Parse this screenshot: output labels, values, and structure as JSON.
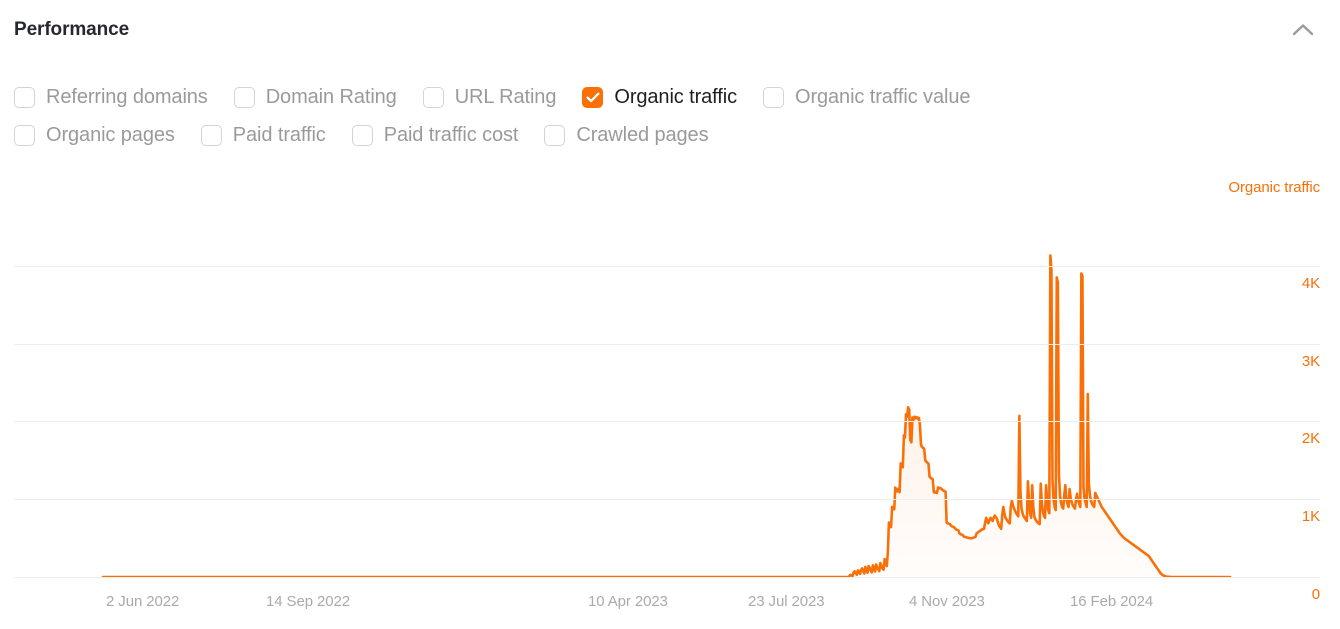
{
  "header": {
    "title": "Performance",
    "collapse_icon": "chevron-up-icon"
  },
  "metrics": {
    "rows": [
      [
        {
          "label": "Referring domains",
          "checked": false
        },
        {
          "label": "Domain Rating",
          "checked": false
        },
        {
          "label": "URL Rating",
          "checked": false
        },
        {
          "label": "Organic traffic",
          "checked": true
        },
        {
          "label": "Organic traffic value",
          "checked": false
        }
      ],
      [
        {
          "label": "Organic pages",
          "checked": false
        },
        {
          "label": "Paid traffic",
          "checked": false
        },
        {
          "label": "Paid traffic cost",
          "checked": false
        },
        {
          "label": "Crawled pages",
          "checked": false
        }
      ]
    ]
  },
  "chart_data": {
    "type": "area",
    "title": "Performance",
    "series_label": "Organic traffic",
    "accent_color": "#F97008",
    "fill_color": "#FDF0E3",
    "grid": true,
    "legend_position": "top-right",
    "xlabel": "",
    "ylabel": "Organic traffic",
    "ylim": [
      0,
      4600
    ],
    "yticks": [
      "0",
      "1K",
      "2K",
      "3K",
      "4K"
    ],
    "ytick_values": [
      0,
      1000,
      2000,
      3000,
      4000
    ],
    "xtick_labels": [
      "2 Jun 2022",
      "14 Sep 2022",
      "10 Apr 2023",
      "23 Jul 2023",
      "4 Nov 2023",
      "16 Feb 2024"
    ],
    "xtick_positions": [
      106,
      266,
      588,
      748,
      909,
      1070
    ],
    "x_start_label": "2 Jun 2022",
    "x_end_label": "16 Feb 2024",
    "values": [
      0,
      0,
      0,
      0,
      0,
      0,
      0,
      0,
      0,
      0,
      0,
      0,
      0,
      0,
      0,
      0,
      0,
      0,
      0,
      0,
      0,
      0,
      0,
      0,
      0,
      0,
      0,
      0,
      0,
      0,
      0,
      0,
      0,
      0,
      0,
      0,
      0,
      0,
      0,
      0,
      0,
      0,
      0,
      0,
      0,
      0,
      0,
      0,
      0,
      0,
      0,
      0,
      0,
      0,
      0,
      0,
      0,
      0,
      0,
      0,
      0,
      0,
      0,
      0,
      0,
      0,
      0,
      0,
      0,
      0,
      0,
      0,
      0,
      0,
      0,
      0,
      0,
      0,
      0,
      0,
      0,
      0,
      0,
      0,
      0,
      0,
      0,
      0,
      0,
      0,
      0,
      0,
      0,
      0,
      0,
      0,
      0,
      0,
      0,
      0,
      0,
      0,
      0,
      0,
      0,
      0,
      0,
      0,
      0,
      0,
      0,
      0,
      0,
      0,
      0,
      0,
      0,
      0,
      0,
      0,
      0,
      0,
      0,
      0,
      0,
      0,
      0,
      0,
      0,
      0,
      0,
      0,
      0,
      0,
      0,
      0,
      0,
      0,
      0,
      0,
      0,
      0,
      0,
      0,
      0,
      0,
      0,
      0,
      0,
      0,
      0,
      0,
      0,
      0,
      0,
      0,
      0,
      0,
      0,
      0,
      0,
      0,
      0,
      0,
      0,
      0,
      0,
      0,
      0,
      0,
      0,
      0,
      0,
      0,
      0,
      0,
      0,
      0,
      0,
      0,
      0,
      0,
      0,
      0,
      0,
      0,
      0,
      0,
      0,
      0,
      0,
      0,
      0,
      0,
      0,
      0,
      0,
      0,
      0,
      0,
      0,
      0,
      0,
      0,
      0,
      0,
      0,
      0,
      0,
      0,
      0,
      0,
      0,
      0,
      0,
      0,
      0,
      0,
      0,
      0,
      0,
      0,
      0,
      0,
      0,
      0,
      0,
      0,
      0,
      0,
      0,
      0,
      0,
      0,
      0,
      0,
      0,
      0,
      0,
      0,
      0,
      0,
      0,
      0,
      0,
      0,
      0,
      0,
      0,
      0,
      0,
      0,
      0,
      0,
      0,
      0,
      0,
      0,
      0,
      0,
      0,
      0,
      0,
      0,
      0,
      0,
      0,
      0,
      0,
      0,
      0,
      0,
      0,
      0,
      0,
      0,
      0,
      0,
      0,
      0,
      0,
      0,
      0,
      0,
      0,
      0,
      0,
      0,
      0,
      0,
      0,
      0,
      0,
      0,
      0,
      0,
      0,
      0,
      0,
      0,
      0,
      0,
      0,
      0,
      0,
      0,
      0,
      0,
      0,
      0,
      0,
      0,
      0,
      0,
      0,
      0,
      0,
      0,
      0,
      0,
      0,
      0,
      0,
      0,
      0,
      0,
      0,
      0,
      0,
      0,
      0,
      0,
      0,
      0,
      0,
      0,
      0,
      0,
      0,
      0,
      0,
      0,
      0,
      0,
      0,
      0,
      0,
      0,
      0,
      0,
      0,
      0,
      0,
      0,
      0,
      0,
      0,
      0,
      0,
      0,
      0,
      0,
      0,
      0,
      0,
      0,
      0,
      0,
      0,
      0,
      0,
      0,
      0,
      0,
      0,
      0,
      0,
      0,
      0,
      0,
      0,
      0,
      0,
      0,
      0,
      0,
      0,
      0,
      0,
      0,
      0,
      0,
      0,
      0,
      0,
      0,
      0,
      0,
      0,
      0,
      0,
      0,
      0,
      0,
      0,
      0,
      0,
      0,
      0,
      0,
      0,
      0,
      0,
      0,
      0,
      0,
      0,
      0,
      0,
      0,
      0,
      0,
      0,
      0,
      0,
      0,
      0,
      0,
      0,
      0,
      0,
      0,
      0,
      0,
      0,
      0,
      0,
      0,
      0,
      0,
      0,
      0,
      0,
      0,
      0,
      0,
      0,
      0,
      0,
      0,
      0,
      0,
      0,
      0,
      0,
      0,
      0,
      0,
      0,
      0,
      0,
      0,
      0,
      0,
      0,
      0,
      0,
      0,
      0,
      0,
      0,
      0,
      0,
      0,
      0,
      0,
      0,
      0,
      0,
      0,
      0,
      0,
      0,
      0,
      0,
      0,
      0,
      0,
      0,
      0,
      0,
      0,
      0,
      0,
      0,
      0,
      0,
      0,
      0,
      0,
      0,
      0,
      0,
      0,
      0,
      0,
      0,
      0,
      0,
      0,
      0,
      0,
      0,
      0,
      0,
      0,
      0,
      0,
      0,
      0,
      0,
      0,
      0,
      0,
      0,
      0,
      0,
      0,
      0,
      0,
      0,
      0,
      0,
      0,
      0,
      0,
      0,
      0,
      0,
      0,
      0,
      0,
      0,
      0,
      0,
      0,
      0,
      0,
      0,
      0,
      0,
      0,
      0,
      0,
      0,
      0,
      0,
      0,
      0,
      0,
      0,
      0,
      0,
      0,
      0,
      0,
      0,
      0,
      0,
      0,
      0,
      0,
      0,
      0,
      0,
      0,
      0,
      0,
      0,
      0,
      0,
      0,
      0,
      0,
      0,
      0,
      0,
      0,
      0,
      0,
      0,
      0,
      0,
      0,
      0,
      0,
      0,
      0,
      0,
      0,
      0,
      0,
      0,
      0,
      0,
      0,
      0,
      0,
      0,
      0,
      0,
      0,
      0,
      0,
      0,
      0,
      0,
      0,
      0,
      0,
      0,
      0,
      0,
      0,
      0,
      0,
      0,
      0,
      0,
      0,
      0,
      0,
      0,
      0,
      0,
      0,
      0,
      0,
      0,
      0,
      0,
      0,
      0,
      0,
      0,
      0,
      0,
      0,
      0,
      0,
      0,
      0,
      0,
      0,
      0,
      0,
      0,
      0,
      0,
      0,
      0,
      0,
      0,
      0,
      0,
      0,
      0,
      0,
      0,
      0,
      0,
      0,
      0,
      0,
      0,
      0,
      0,
      0,
      0,
      0,
      0,
      0,
      0,
      0,
      0,
      0,
      0,
      0,
      0,
      0,
      0,
      0,
      0,
      0,
      0,
      0,
      0,
      0,
      12,
      28,
      18,
      10,
      60,
      72,
      48,
      30,
      85,
      64,
      40,
      95,
      110,
      70,
      45,
      130,
      90,
      55,
      140,
      120,
      80,
      60,
      150,
      105,
      70,
      160,
      125,
      95,
      75,
      180,
      140,
      110,
      95,
      230,
      175,
      140,
      320,
      700,
      660,
      640,
      900,
      880,
      870,
      1150,
      1120,
      1100,
      1135,
      1090,
      1460,
      1430,
      1410,
      1820,
      1790,
      2090,
      2060,
      2180,
      2150,
      1760,
      1730,
      2050,
      2020,
      2060,
      2040,
      2055,
      2035,
      2045,
      1960,
      1700,
      1670,
      1660,
      1645,
      1500,
      1480,
      1470,
      1455,
      1290,
      1275,
      1265,
      1255,
      1090,
      1085,
      1095,
      1080,
      1150,
      1140,
      1145,
      1135,
      1120,
      1110,
      1105,
      1095,
      700,
      690,
      685,
      680,
      660,
      650,
      645,
      640,
      620,
      610,
      605,
      600,
      560,
      550,
      545,
      540,
      520,
      515,
      512,
      508,
      505,
      500,
      498,
      496,
      500,
      505,
      510,
      515,
      560,
      570,
      580,
      590,
      600,
      610,
      615,
      620,
      700,
      760,
      720,
      690,
      730,
      760,
      740,
      720,
      760,
      790,
      770,
      750,
      700,
      660,
      640,
      620,
      800,
      900,
      820,
      760,
      740,
      720,
      700,
      690,
      900,
      980,
      920,
      880,
      850,
      820,
      800,
      780,
      2070,
      1100,
      880,
      820,
      780,
      760,
      740,
      720,
      1230,
      980,
      820,
      760,
      1180,
      900,
      780,
      740,
      720,
      700,
      690,
      680,
      1200,
      960,
      840,
      790,
      760,
      1180,
      980,
      860,
      820,
      4130,
      3950,
      1250,
      1000,
      900,
      860,
      3850,
      3780,
      1320,
      1050,
      950,
      900,
      880,
      1050,
      1180,
      1000,
      940,
      900,
      1130,
      1020,
      960,
      920,
      900,
      880,
      1000,
      1070,
      980,
      940,
      900,
      3900,
      3870,
      1150,
      1000,
      950,
      900,
      2350,
      1200,
      1050,
      980,
      940,
      920,
      900,
      1080,
      1050,
      1020,
      990,
      960,
      930,
      900,
      880,
      860,
      840,
      820,
      800,
      780,
      760,
      740,
      720,
      700,
      680,
      660,
      640,
      620,
      600,
      580,
      560,
      545,
      530,
      515,
      500,
      490,
      480,
      470,
      460,
      450,
      440,
      430,
      420,
      410,
      400,
      390,
      380,
      370,
      360,
      350,
      340,
      330,
      320,
      310,
      300,
      290,
      280,
      270,
      250,
      230,
      210,
      190,
      170,
      150,
      130,
      110,
      90,
      70,
      50,
      35,
      25,
      18,
      12,
      8,
      5,
      3,
      2,
      1,
      0,
      0,
      0,
      0,
      0,
      0,
      0,
      0,
      0,
      0,
      0,
      0,
      0,
      0,
      0,
      0,
      0,
      0,
      0,
      0,
      0,
      0,
      0,
      0,
      0,
      0,
      0,
      0,
      0,
      0,
      0,
      0,
      0,
      0,
      0,
      0,
      0,
      0,
      0,
      0,
      0,
      0,
      0,
      0,
      0,
      0,
      0,
      0,
      0,
      0,
      0,
      0,
      0,
      0,
      0,
      0
    ]
  }
}
